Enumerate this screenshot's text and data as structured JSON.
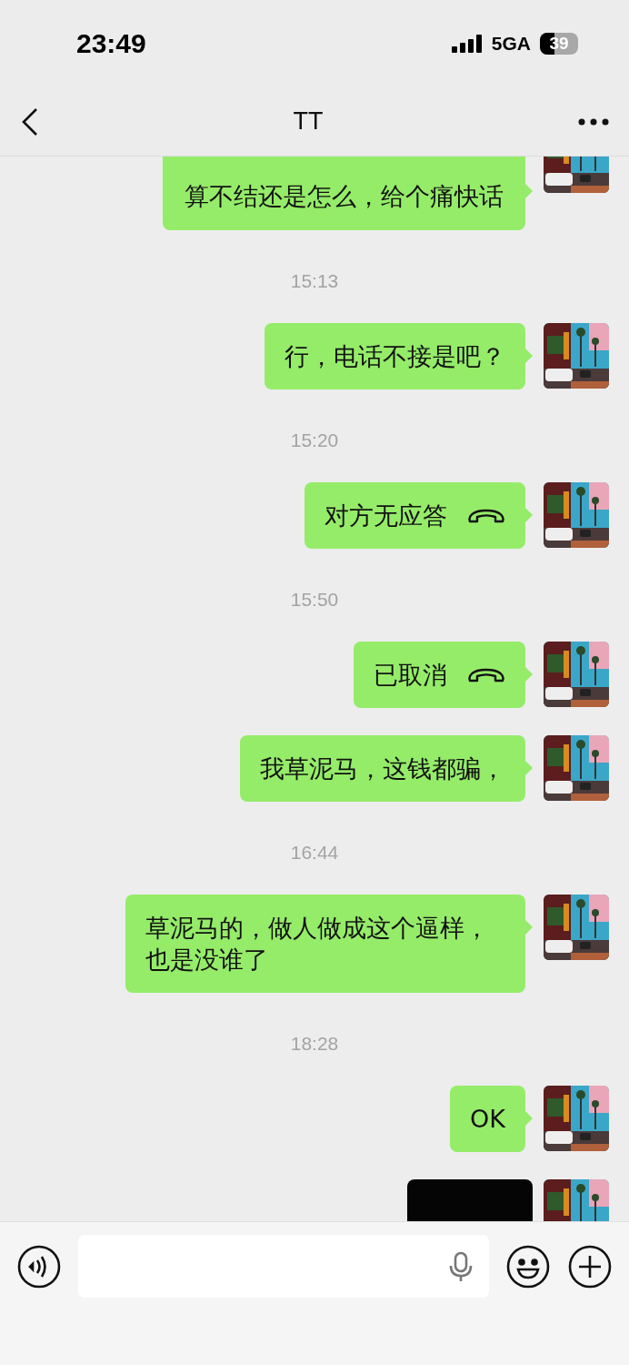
{
  "status_bar": {
    "time": "23:49",
    "network": "5GA",
    "battery": "39"
  },
  "header": {
    "title": "TT"
  },
  "chat": [
    {
      "kind": "text",
      "text": "算不结还是怎么，给个痛快话",
      "clipped": true
    },
    {
      "kind": "time",
      "text": "15:13"
    },
    {
      "kind": "text",
      "text": "行，电话不接是吧？",
      "clipped": false
    },
    {
      "kind": "time",
      "text": "15:20"
    },
    {
      "kind": "call",
      "text": "对方无应答"
    },
    {
      "kind": "time",
      "text": "15:50"
    },
    {
      "kind": "call",
      "text": "已取消"
    },
    {
      "kind": "text",
      "text": "我草泥马，这钱都骗，",
      "clipped": false
    },
    {
      "kind": "time",
      "text": "16:44"
    },
    {
      "kind": "text",
      "text": "草泥马的，做人做成这个逼样，也是没谁了",
      "clipped": false
    },
    {
      "kind": "time",
      "text": "18:28"
    },
    {
      "kind": "text",
      "text": "OK",
      "clipped": false
    },
    {
      "kind": "media"
    }
  ]
}
